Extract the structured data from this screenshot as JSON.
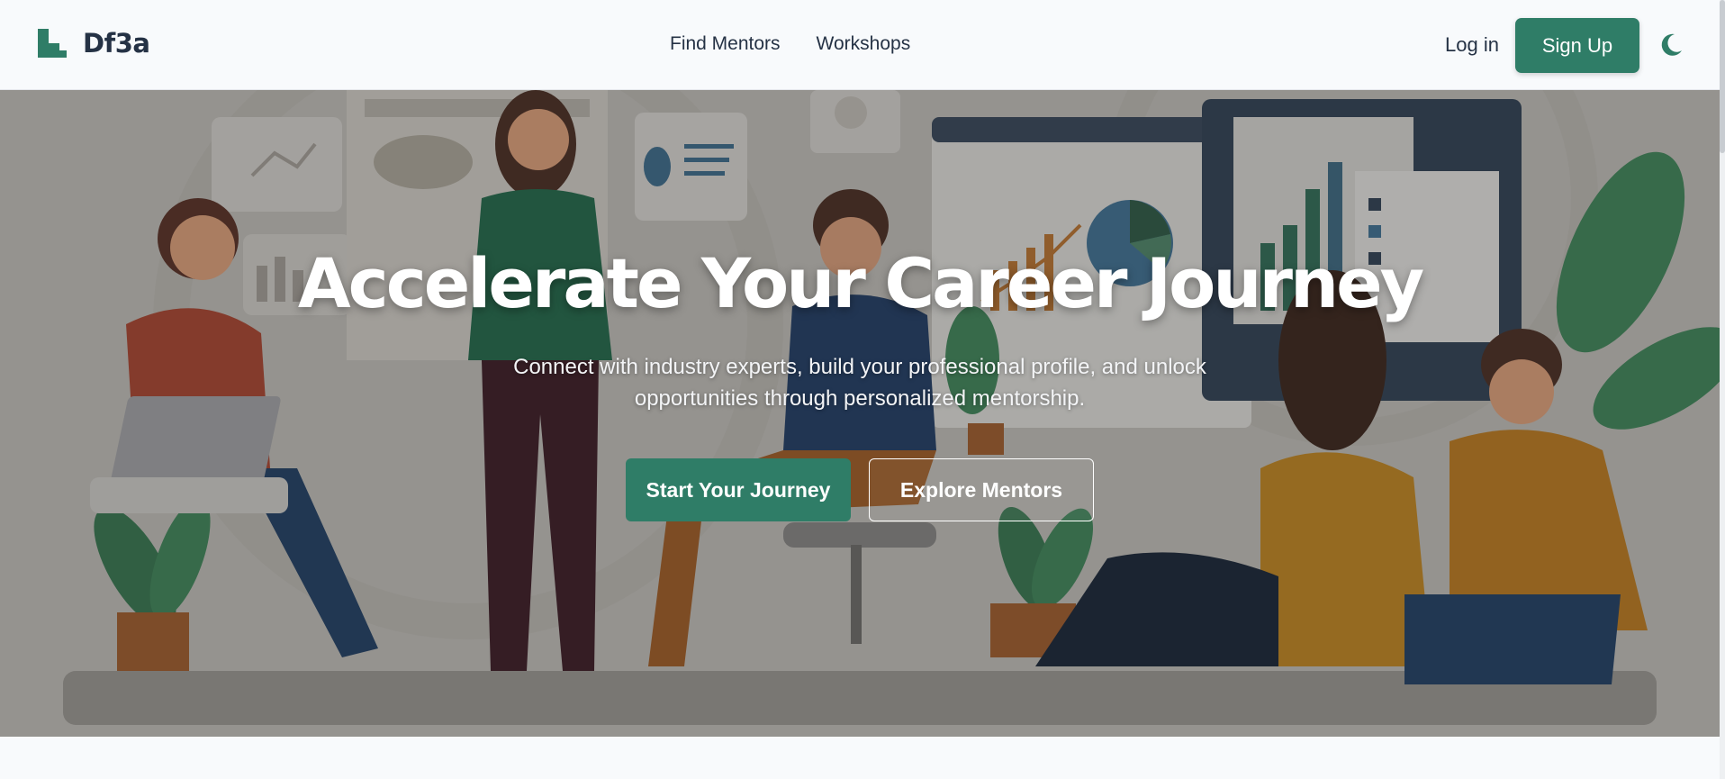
{
  "brand": {
    "name": "Df3a",
    "logo_icon": "steps-logo-icon"
  },
  "nav": {
    "links": [
      {
        "label": "Find Mentors"
      },
      {
        "label": "Workshops"
      }
    ],
    "login_label": "Log in",
    "signup_label": "Sign Up",
    "theme_icon": "moon-icon"
  },
  "hero": {
    "title": "Accelerate Your Career Journey",
    "subtitle": "Connect with industry experts, build your professional profile, and unlock opportunities through personalized mentorship.",
    "primary_cta": "Start Your Journey",
    "secondary_cta": "Explore Mentors",
    "background_illustration": "team-collaboration-illustration"
  },
  "colors": {
    "accent": "#2f7d67",
    "text_dark": "#253245",
    "page_bg": "#f8fafc"
  }
}
